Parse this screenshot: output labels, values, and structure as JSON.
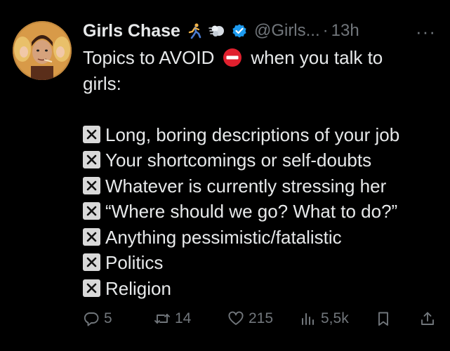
{
  "author": {
    "name": "Girls Chase",
    "handle": "@Girls...",
    "separator": "·",
    "time": "13h",
    "emoji_1": "runner-emoji",
    "emoji_2": "dash-emoji",
    "verified": true
  },
  "more_label": "···",
  "tweet": {
    "intro_before": "Topics to AVOID",
    "intro_after": "when you talk to",
    "intro_line2": "girls:",
    "items": [
      "Long, boring descriptions of your job",
      "Your shortcomings or self-doubts",
      "Whatever is currently stressing her",
      "“Where should we go? What to do?”",
      "Anything pessimistic/fatalistic",
      "Politics",
      "Religion"
    ]
  },
  "actions": {
    "replies": "5",
    "retweets": "14",
    "likes": "215",
    "views": "5,5k"
  },
  "colors": {
    "background": "#000000",
    "text": "#e7e9ea",
    "secondary": "#71767b",
    "verified": "#1d9bf0",
    "no_entry": "#e0202e"
  }
}
